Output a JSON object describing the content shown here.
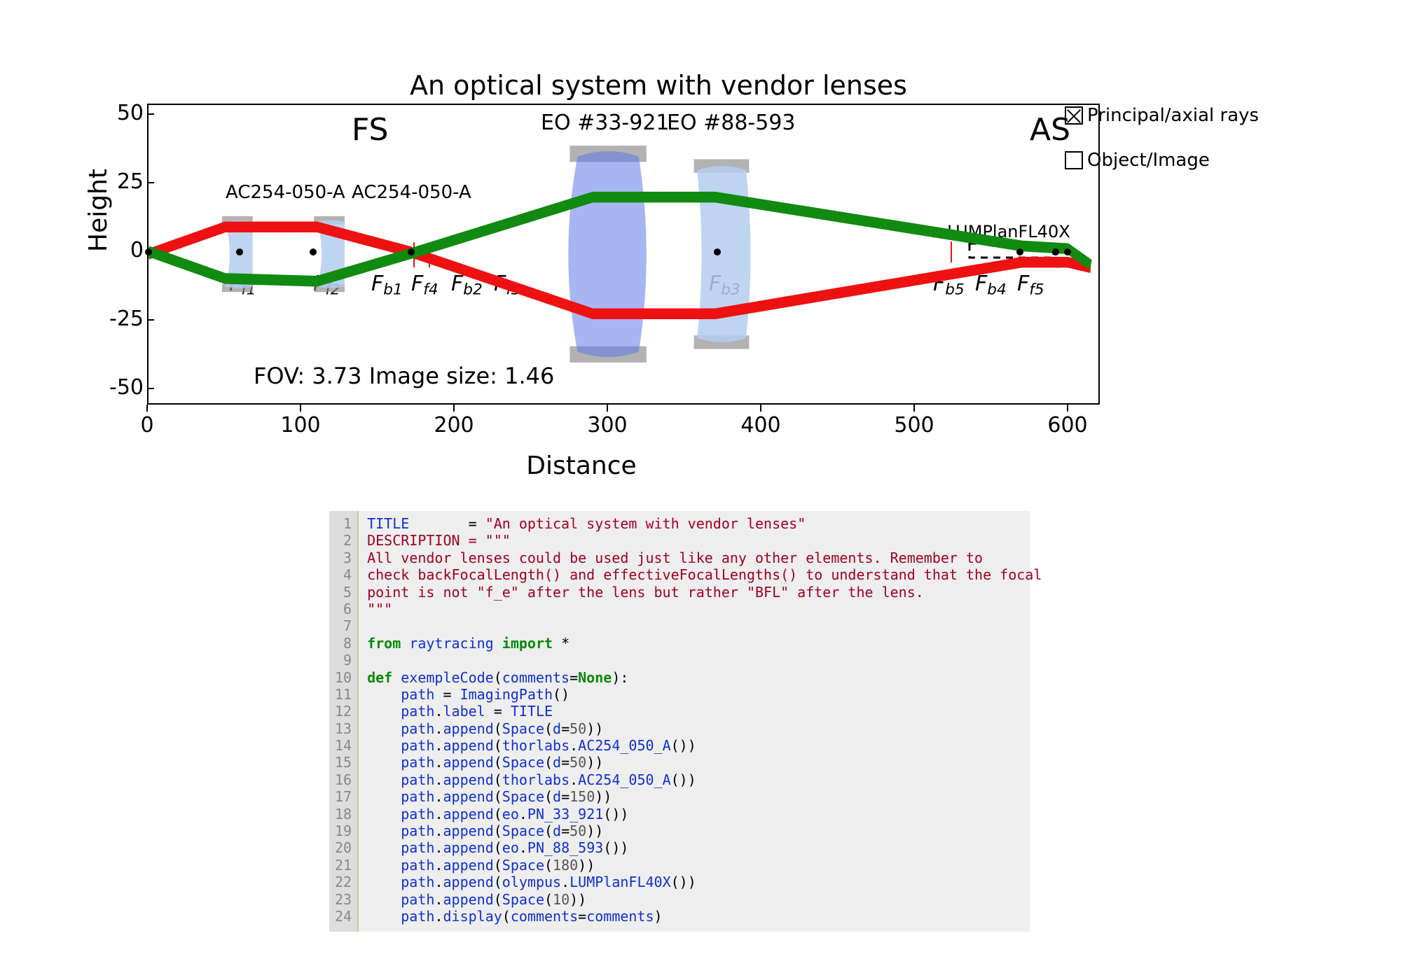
{
  "chart_data": {
    "type": "line",
    "title": "An optical system with vendor lenses",
    "xlabel": "Distance",
    "ylabel": "Height",
    "xlim": [
      0,
      620
    ],
    "ylim": [
      -55,
      55
    ],
    "xticks": [
      0,
      100,
      200,
      300,
      400,
      500,
      600
    ],
    "yticks": [
      -50,
      -25,
      0,
      25,
      50
    ],
    "series": [
      {
        "name": "Principal ray (red)",
        "color": "#e11",
        "x": [
          0,
          50,
          110,
          170,
          290,
          370,
          570,
          600,
          615
        ],
        "y": [
          0,
          10,
          10,
          1,
          -22,
          -22,
          -3,
          -3,
          -5
        ]
      },
      {
        "name": "Axial ray (green)",
        "color": "#108a10",
        "x": [
          0,
          50,
          110,
          170,
          290,
          370,
          570,
          600,
          615
        ],
        "y": [
          1,
          -9,
          -10,
          0,
          21,
          21,
          3,
          2,
          -4
        ]
      }
    ],
    "lens_labels_top": [
      "EO #33-921",
      "EO #88-593"
    ],
    "lens_labels_mid": [
      "AC254-050-A",
      "AC254-050-A"
    ],
    "stop_labels": {
      "field_stop": "FS",
      "aperture_stop": "AS"
    },
    "objective_label": "LUMPlanFL40X",
    "focal_labels": [
      "F_{f1}",
      "F_{f2}",
      "F_{b1}",
      "F_{f4}",
      "F_{b2}",
      "F_{f3}",
      "F_{b3}",
      "F_{b5}",
      "F_{b4}",
      "F_{f5}"
    ],
    "annotation_bottom": "FOV: 3.73 Image size: 1.46",
    "principal_points_x": [
      0,
      59,
      107,
      170,
      370,
      567,
      590,
      598
    ],
    "legend": [
      "Principal/axial rays",
      "Object/Image"
    ]
  },
  "code": {
    "lines": [
      {
        "n": 1,
        "t": "TITLE       = \"An optical system with vendor lenses\""
      },
      {
        "n": 2,
        "t": "DESCRIPTION = \"\"\""
      },
      {
        "n": 3,
        "t": "All vendor lenses could be used just like any other elements. Remember to"
      },
      {
        "n": 4,
        "t": "check backFocalLength() and effectiveFocalLengths() to understand that the focal"
      },
      {
        "n": 5,
        "t": "point is not \"f_e\" after the lens but rather \"BFL\" after the lens."
      },
      {
        "n": 6,
        "t": "\"\"\""
      },
      {
        "n": 7,
        "t": ""
      },
      {
        "n": 8,
        "t": "from raytracing import *"
      },
      {
        "n": 9,
        "t": ""
      },
      {
        "n": 10,
        "t": "def exempleCode(comments=None):"
      },
      {
        "n": 11,
        "t": "    path = ImagingPath()"
      },
      {
        "n": 12,
        "t": "    path.label = TITLE"
      },
      {
        "n": 13,
        "t": "    path.append(Space(d=50))"
      },
      {
        "n": 14,
        "t": "    path.append(thorlabs.AC254_050_A())"
      },
      {
        "n": 15,
        "t": "    path.append(Space(d=50))"
      },
      {
        "n": 16,
        "t": "    path.append(thorlabs.AC254_050_A())"
      },
      {
        "n": 17,
        "t": "    path.append(Space(d=150))"
      },
      {
        "n": 18,
        "t": "    path.append(eo.PN_33_921())"
      },
      {
        "n": 19,
        "t": "    path.append(Space(d=50))"
      },
      {
        "n": 20,
        "t": "    path.append(eo.PN_88_593())"
      },
      {
        "n": 21,
        "t": "    path.append(Space(180))"
      },
      {
        "n": 22,
        "t": "    path.append(olympus.LUMPlanFL40X())"
      },
      {
        "n": 23,
        "t": "    path.append(Space(10))"
      },
      {
        "n": 24,
        "t": "    path.display(comments=comments)"
      }
    ]
  }
}
